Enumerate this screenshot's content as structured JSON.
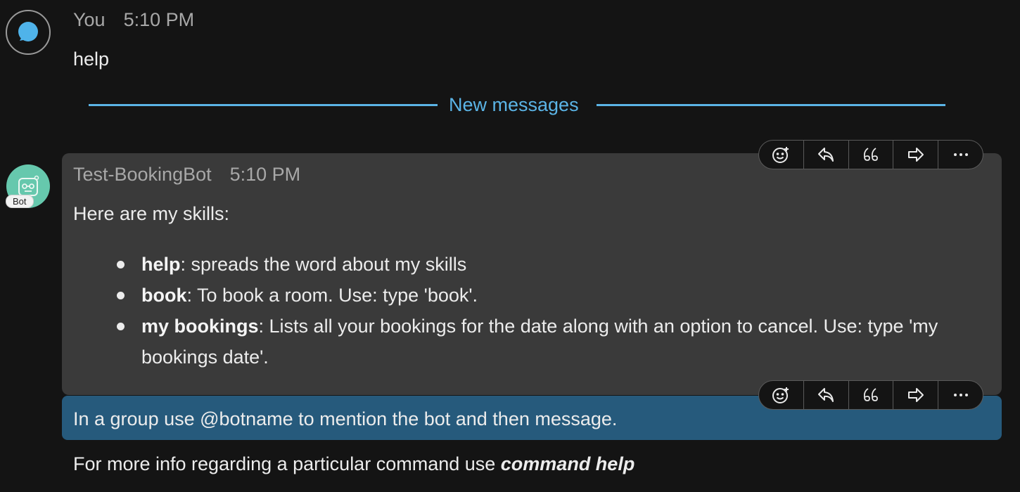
{
  "user_message": {
    "sender": "You",
    "time": "5:10 PM",
    "text": "help"
  },
  "divider": {
    "label": "New messages",
    "color": "#5bb4e6"
  },
  "bot_message": {
    "sender": "Test-BookingBot",
    "time": "5:10 PM",
    "badge": "Bot",
    "intro": "Here are my skills:",
    "skills": [
      {
        "name": "help",
        "desc": ": spreads the word about my skills"
      },
      {
        "name": "book",
        "desc": ": To book a room. Use: type 'book'."
      },
      {
        "name": "my bookings",
        "desc": ": Lists all your bookings for the date along with an option to cancel. Use: type 'my bookings date'."
      }
    ],
    "group_hint": "In a group use @botname to mention the bot and then message.",
    "more_info_prefix": "For more info regarding a particular command use ",
    "more_info_command": "command help"
  },
  "toolbar_icons": [
    "emoji-icon",
    "reply-icon",
    "quote-icon",
    "forward-icon",
    "more-icon"
  ],
  "colors": {
    "background": "#141414",
    "card": "#3a3a3a",
    "highlight": "#265a7c",
    "bot_avatar": "#66c8ad",
    "user_avatar_icon": "#4fb3ea"
  }
}
